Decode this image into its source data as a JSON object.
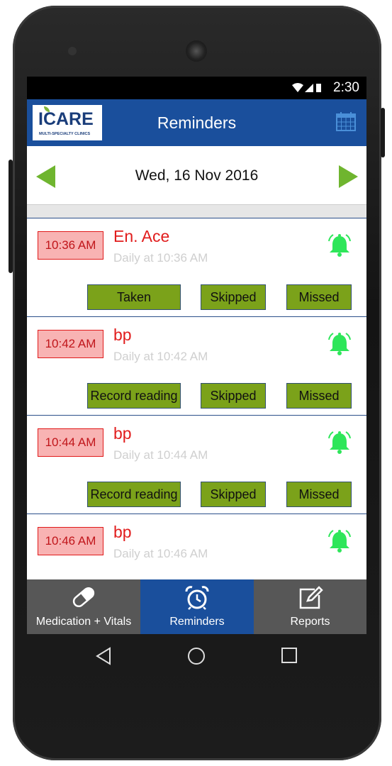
{
  "status": {
    "time": "2:30",
    "icons": "wifi signal battery"
  },
  "appbar": {
    "title": "Reminders",
    "logo_text": "ICARE",
    "logo_sub": "MULTI-SPECIALTY CLINICS"
  },
  "datebar": {
    "date": "Wed, 16 Nov 2016"
  },
  "reminders": [
    {
      "time": "10:36 AM",
      "name": "En. Ace",
      "freq": "Daily at 10:36 AM",
      "actions": [
        "Taken",
        "Skipped",
        "Missed"
      ]
    },
    {
      "time": "10:42 AM",
      "name": "bp",
      "freq": "Daily at 10:42 AM",
      "actions": [
        "Record reading",
        "Skipped",
        "Missed"
      ]
    },
    {
      "time": "10:44 AM",
      "name": "bp",
      "freq": "Daily at 10:44 AM",
      "actions": [
        "Record reading",
        "Skipped",
        "Missed"
      ]
    },
    {
      "time": "10:46 AM",
      "name": "bp",
      "freq": "Daily at 10:46 AM",
      "actions": []
    }
  ],
  "bottomnav": [
    {
      "label": "Medication + Vitals",
      "icon": "pill-icon"
    },
    {
      "label": "Reminders",
      "icon": "alarm-clock-icon"
    },
    {
      "label": "Reports",
      "icon": "edit-icon"
    }
  ],
  "colors": {
    "appbar": "#1a4f9c",
    "nav": "#575757",
    "accent_green": "#7ba21a",
    "alert_red": "#e11d1d"
  }
}
